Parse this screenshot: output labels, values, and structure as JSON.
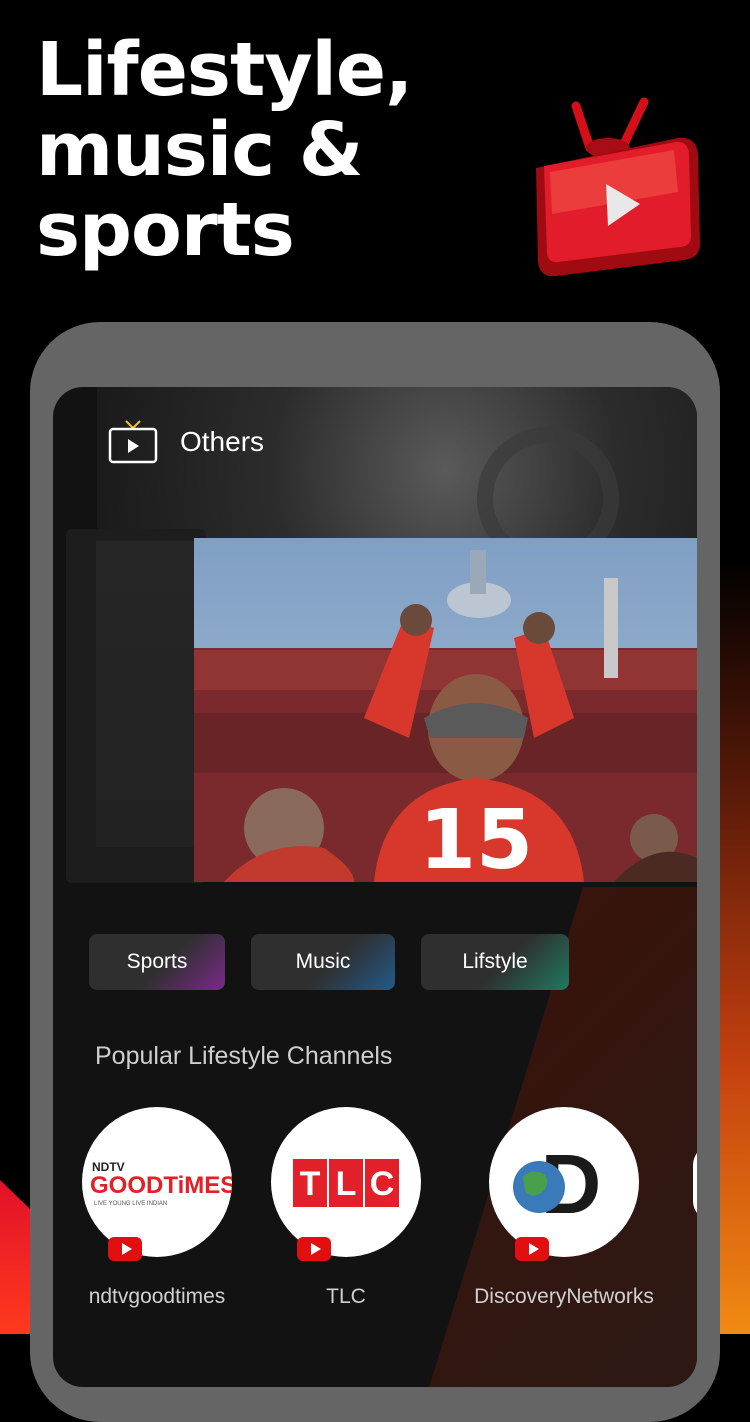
{
  "headline": [
    "Lifestyle,",
    "music &",
    "sports"
  ],
  "logo_icon": "tv-play-logo-icon",
  "screen": {
    "header": {
      "icon": "tv-icon",
      "title": "Others"
    },
    "hero": {
      "jersey_number": "15"
    },
    "chips": [
      {
        "label": "Sports",
        "accent": "#7a2a8a"
      },
      {
        "label": "Music",
        "accent": "#235a8a"
      },
      {
        "label": "Lifstyle",
        "accent": "#1f7a60"
      }
    ],
    "section_title": "Popular Lifestyle Channels",
    "channels": [
      {
        "name": "ndtvgoodtimes",
        "logo_top": "NDTV",
        "logo_main": "GOODTiMES",
        "logo_sub": "LIVE YOUNG LIVE INDIAN"
      },
      {
        "name": "TLC",
        "logo_letters": [
          "T",
          "L",
          "C"
        ]
      },
      {
        "name": "DiscoveryNetworks",
        "logo_letter": "D"
      }
    ]
  },
  "colors": {
    "brand_red": "#e10f0f",
    "background": "#000000",
    "phone_frame": "#656565"
  }
}
